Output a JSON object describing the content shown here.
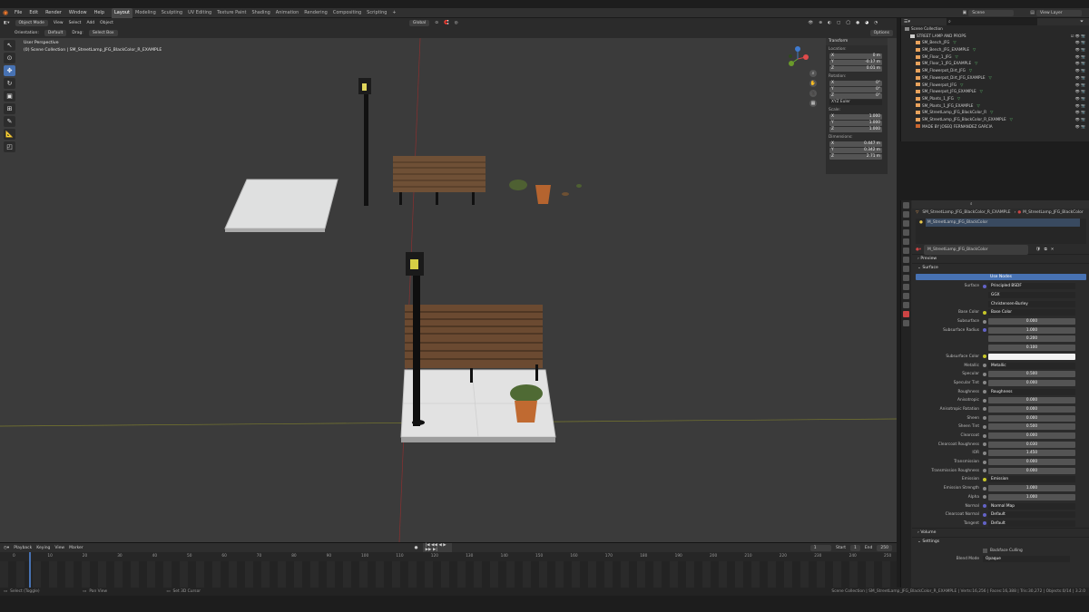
{
  "menubar": {
    "items": [
      "File",
      "Edit",
      "Render",
      "Window",
      "Help"
    ],
    "tabs": [
      "Layout",
      "Modeling",
      "Sculpting",
      "UV Editing",
      "Texture Paint",
      "Shading",
      "Animation",
      "Rendering",
      "Compositing",
      "Scripting"
    ],
    "active_tab": "Layout",
    "scene": "Scene",
    "view_layer": "View Layer"
  },
  "viewport_header": {
    "mode": "Object Mode",
    "menus": [
      "View",
      "Select",
      "Add",
      "Object"
    ],
    "orientation_label": "Orientation:",
    "orientation": "Default",
    "drag": "Drag:",
    "drag_value": "Select Box",
    "transform_global": "Global",
    "options": "Options"
  },
  "viewport_info": {
    "line1": "User Perspective",
    "line2": "(0) Scene Collection | SM_StreetLamp_JFG_BlackColor_R_EXAMPLE"
  },
  "npanel": {
    "title": "Transform",
    "location_label": "Location:",
    "location": [
      [
        "X",
        "0 m"
      ],
      [
        "Y",
        "-0.17 m"
      ],
      [
        "Z",
        "0.01 m"
      ]
    ],
    "rotation_label": "Rotation:",
    "rotation": [
      [
        "X",
        "0°"
      ],
      [
        "Y",
        "0°"
      ],
      [
        "Z",
        "0°"
      ]
    ],
    "rotation_mode": "XYZ Euler",
    "scale_label": "Scale:",
    "scale": [
      [
        "X",
        "1.000"
      ],
      [
        "Y",
        "1.000"
      ],
      [
        "Z",
        "1.000"
      ]
    ],
    "dimensions_label": "Dimensions:",
    "dimensions": [
      [
        "X",
        "0.447 m"
      ],
      [
        "Y",
        "0.342 m"
      ],
      [
        "Z",
        "2.71 m"
      ]
    ]
  },
  "timeline": {
    "menus": [
      "Playback",
      "Keying",
      "View",
      "Marker"
    ],
    "current_frame": "1",
    "start_label": "Start",
    "start": "1",
    "end_label": "End",
    "end": "250",
    "ticks": [
      "0",
      "10",
      "20",
      "30",
      "40",
      "50",
      "60",
      "70",
      "80",
      "90",
      "100",
      "110",
      "120",
      "130",
      "140",
      "150",
      "160",
      "170",
      "180",
      "190",
      "200",
      "210",
      "220",
      "230",
      "240",
      "250"
    ]
  },
  "statusbar": {
    "select": "Select (Toggle)",
    "pan": "Pan View",
    "set_cursor": "Set 3D Cursor",
    "right": "Scene Collection | SM_StreetLamp_JFG_BlackColor_R_EXAMPLE | Verts:16,256 | Faces:16,388 | Tris:30,272 | Objects:0/14 | 3.2.0"
  },
  "outliner": {
    "header": "Scene Collection",
    "collection": "STREET LAMP AND PROPS",
    "items": [
      "SM_Bench_JFG",
      "SM_Bench_JFG_EXAMPLE",
      "SM_Floor_1_JFG",
      "SM_Floor_1_JFG_EXAMPLE",
      "SM_Flowerpot_Dirt_JFG",
      "SM_Flowerpot_Dirt_JFG_EXAMPLE",
      "SM_Flowerpot_JFG",
      "SM_Flowerpot_JFG_EXAMPLE",
      "SM_Plants_1_JFG",
      "SM_Plants_1_JFG_EXAMPLE",
      "SM_StreetLamp_JFG_BlackColor_R",
      "SM_StreetLamp_JFG_BlackColor_R_EXAMPLE"
    ],
    "footer": "MADE BY JOSEQ FERNANDEZ GARCIA"
  },
  "properties": {
    "breadcrumb_object": "SM_StreetLamp_JFG_BlackColor_R_EXAMPLE",
    "breadcrumb_material": "M_StreetLamp_JFG_BlackColor",
    "slot": "M_StreetLamp_JFG_BlackColor",
    "material_name": "M_StreetLamp_JFG_BlackColor",
    "preview": "Preview",
    "surface": "Surface",
    "use_nodes": "Use Nodes",
    "rows": [
      {
        "k": "Surface",
        "v": "Principled BSDF",
        "type": "dark",
        "dot": "g"
      },
      {
        "k": "",
        "v": "GGX",
        "type": "dark"
      },
      {
        "k": "",
        "v": "Christensen-Burley",
        "type": "dark"
      },
      {
        "k": "Base Color",
        "v": "Base Color",
        "type": "dark",
        "dot": "y"
      },
      {
        "k": "Subsurface",
        "v": "0.000",
        "type": "num",
        "dot": "grey"
      },
      {
        "k": "Subsurface Radius",
        "v": "1.000",
        "type": "num",
        "dot": "g"
      },
      {
        "k": "",
        "v": "0.200",
        "type": "num"
      },
      {
        "k": "",
        "v": "0.100",
        "type": "num"
      },
      {
        "k": "Subsurface Color",
        "v": "",
        "type": "white",
        "dot": "y"
      },
      {
        "k": "Metallic",
        "v": "Metallic",
        "type": "dark",
        "dot": "grey"
      },
      {
        "k": "Specular",
        "v": "0.500",
        "type": "fill",
        "fill": 0.5,
        "dot": "grey"
      },
      {
        "k": "Specular Tint",
        "v": "0.000",
        "type": "num",
        "dot": "grey"
      },
      {
        "k": "Roughness",
        "v": "Roughness",
        "type": "dark",
        "dot": "grey"
      },
      {
        "k": "Anisotropic",
        "v": "0.000",
        "type": "num",
        "dot": "grey"
      },
      {
        "k": "Anisotropic Rotation",
        "v": "0.000",
        "type": "num",
        "dot": "grey"
      },
      {
        "k": "Sheen",
        "v": "0.000",
        "type": "num",
        "dot": "grey"
      },
      {
        "k": "Sheen Tint",
        "v": "0.500",
        "type": "fill",
        "fill": 0.5,
        "dot": "grey"
      },
      {
        "k": "Clearcoat",
        "v": "0.000",
        "type": "num",
        "dot": "grey"
      },
      {
        "k": "Clearcoat Roughness",
        "v": "0.030",
        "type": "fill",
        "fill": 0.03,
        "dot": "grey"
      },
      {
        "k": "IOR",
        "v": "1.450",
        "type": "num",
        "dot": "grey"
      },
      {
        "k": "Transmission",
        "v": "0.000",
        "type": "num",
        "dot": "grey"
      },
      {
        "k": "Transmission Roughness",
        "v": "0.000",
        "type": "num",
        "dot": "grey"
      },
      {
        "k": "Emission",
        "v": "Emission",
        "type": "dark",
        "dot": "y"
      },
      {
        "k": "Emission Strength",
        "v": "1.000",
        "type": "num",
        "dot": "grey"
      },
      {
        "k": "Alpha",
        "v": "1.000",
        "type": "fill",
        "fill": 1.0,
        "dot": "grey"
      },
      {
        "k": "Normal",
        "v": "Normal Map",
        "type": "dark",
        "dot": "g"
      },
      {
        "k": "Clearcoat Normal",
        "v": "Default",
        "type": "dark",
        "dot": "g"
      },
      {
        "k": "Tangent",
        "v": "Default",
        "type": "dark",
        "dot": "g"
      }
    ],
    "volume": "Volume",
    "settings": "Settings",
    "backface": "Backface Culling",
    "blend_label": "Blend Mode",
    "blend": "Opaque"
  },
  "colors": {
    "accent": "#4772b3",
    "bg": "#3b3b3b"
  }
}
